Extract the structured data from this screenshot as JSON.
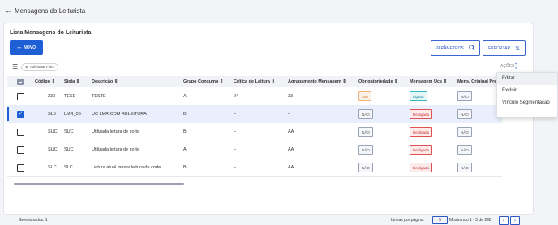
{
  "header": {
    "title": "Mensagens do Leiturista"
  },
  "card": {
    "title": "Lista Mensagens do Leiturista"
  },
  "toolbar": {
    "novo_label": "NOVO",
    "parametros_label": "PARÂMETROS",
    "exportar_label": "EXPORTAR"
  },
  "filter": {
    "chip_label": "Adicionar Filtro"
  },
  "acoes": {
    "label": "AÇÕES"
  },
  "columns": [
    "Código",
    "Sigla",
    "Descrição",
    "Grupo Consumo",
    "Crítica de Leitura",
    "Agrupamento Mensagem",
    "Obrigatoriedade",
    "Mensagem Ucs",
    "Mens. Original Pre"
  ],
  "rows": [
    {
      "codigo": "233",
      "sigla": "TESE",
      "descricao": "TESTE",
      "grupo": "A",
      "critica": "24",
      "agrupamento": "33",
      "obrig": "SIM",
      "msg_ucs": "Ligada",
      "mens_orig": "NÃO",
      "selected": false
    },
    {
      "codigo": "SL6",
      "sigla": "LMR_06",
      "descricao": "UC LMR COM RELEITURA",
      "grupo": "B",
      "critica": "–",
      "agrupamento": "–",
      "obrig": "NÃO",
      "msg_ucs": "Desligada",
      "mens_orig": "NÃO",
      "selected": true
    },
    {
      "codigo": "SUC",
      "sigla": "SUC",
      "descricao": "Utilizada leitura de corte",
      "grupo": "B",
      "critica": "–",
      "agrupamento": "AA",
      "obrig": "NÃO",
      "msg_ucs": "Desligada",
      "mens_orig": "NÃO",
      "selected": false
    },
    {
      "codigo": "SUC",
      "sigla": "SUC",
      "descricao": "Utilizada leitura de corte",
      "grupo": "A",
      "critica": "–",
      "agrupamento": "AA",
      "obrig": "NÃO",
      "msg_ucs": "Desligada",
      "mens_orig": "NÃO",
      "selected": false
    },
    {
      "codigo": "SLC",
      "sigla": "SLC",
      "descricao": "Leitura atual menor leitura de corte",
      "grupo": "B",
      "critica": "–",
      "agrupamento": "AA",
      "obrig": "NÃO",
      "msg_ucs": "Desligada",
      "mens_orig": "NÃO",
      "selected": false
    }
  ],
  "context_menu": [
    "Editar",
    "Excluir",
    "Vínculo Segmentação"
  ],
  "footer": {
    "selected": "Selecionados: 1",
    "per_page_label": "Linhas por página:",
    "per_page": "5",
    "range": "Mostrando 1 - 5 de 298"
  },
  "colors": {
    "primary": "#1f5fd6",
    "danger": "#e05252",
    "success": "#38b9c8",
    "warning": "#f0b37a"
  }
}
